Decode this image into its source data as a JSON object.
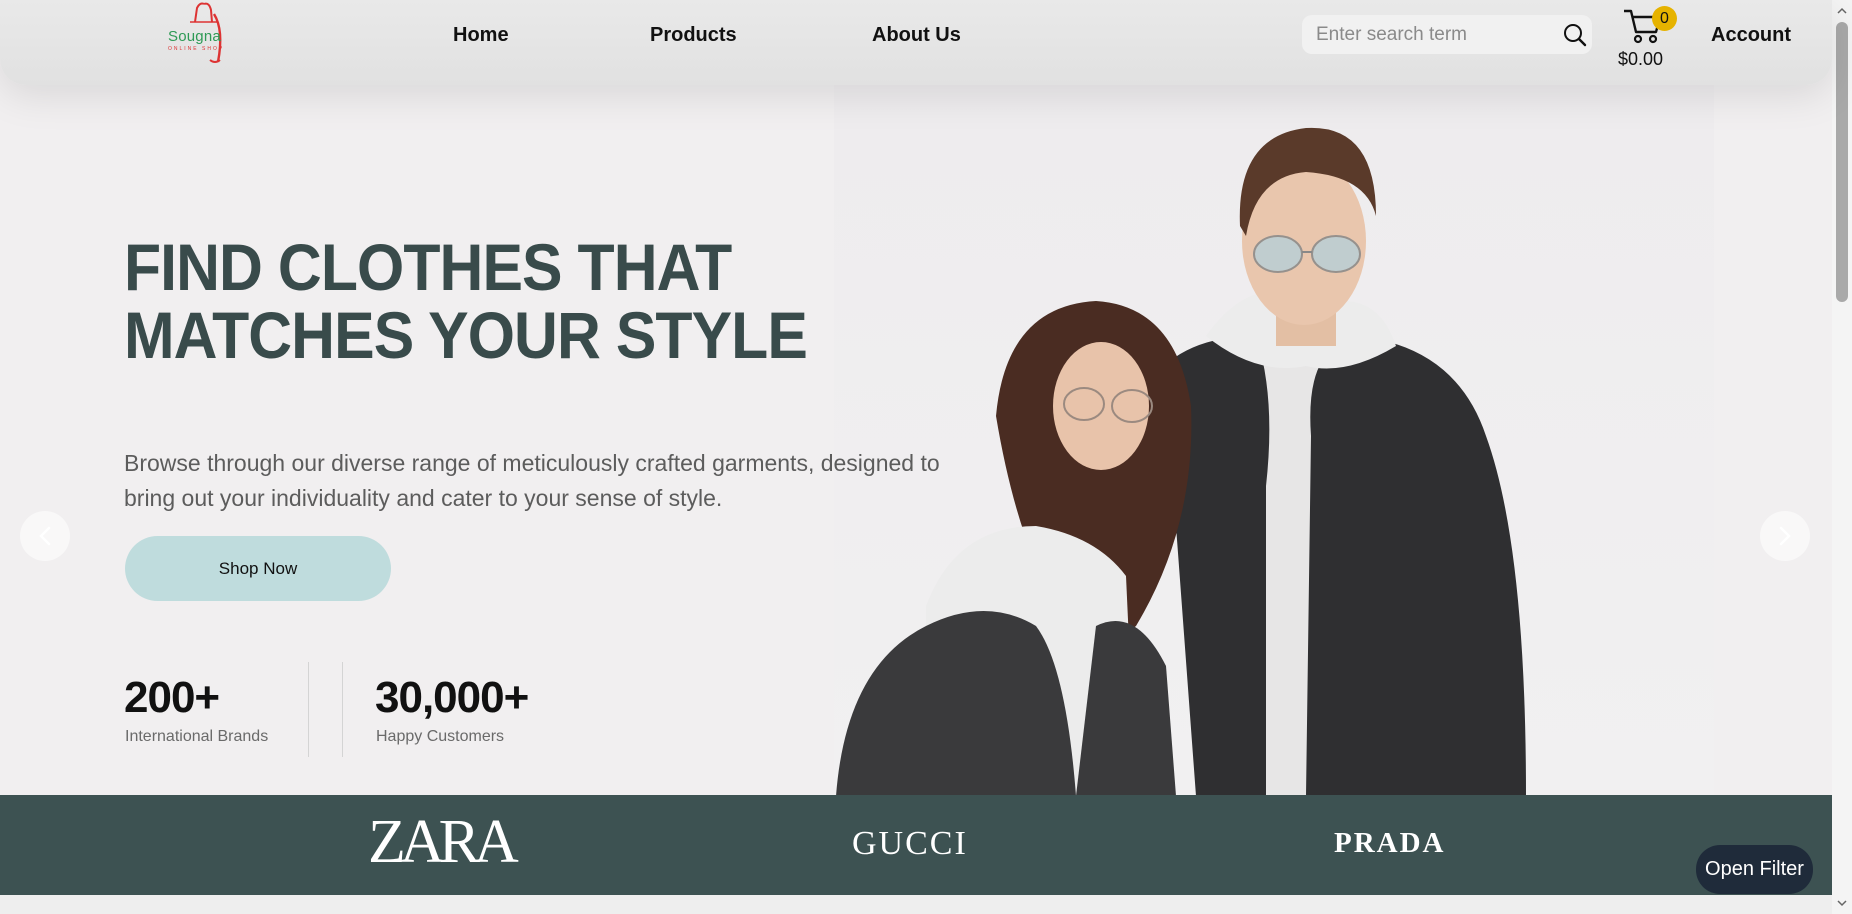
{
  "brand": {
    "logo_text": "Sougna",
    "logo_sub": "ONLINE SHOP",
    "logo_icon": "shopping-bag-icon"
  },
  "header": {
    "nav": [
      "Home",
      "Products",
      "About Us"
    ],
    "search": {
      "placeholder": "Enter search term",
      "value": ""
    },
    "cart": {
      "count": "0",
      "total": "$0.00"
    },
    "account": "Account"
  },
  "hero": {
    "headline": "FIND CLOTHES THAT MATCHES YOUR STYLE",
    "subtext": "Browse through our diverse range of meticulously crafted garments, designed to bring out your individuality and cater to your sense of style.",
    "cta": "Shop Now",
    "stats": [
      {
        "value": "200+",
        "label": "International Brands"
      },
      {
        "value": "30,000+",
        "label": "Happy Customers"
      }
    ],
    "slide_count": 5,
    "active_slide": 1
  },
  "brands": [
    "ZARA",
    "GUCCI",
    "PRADA"
  ],
  "filter": {
    "label": "Open Filter"
  },
  "colors": {
    "accent_dark": "#3d5252",
    "headline": "#394b4b",
    "cta_bg": "#bfdcdd",
    "badge": "#e6b300",
    "filter_bg": "#1f2b3a"
  }
}
